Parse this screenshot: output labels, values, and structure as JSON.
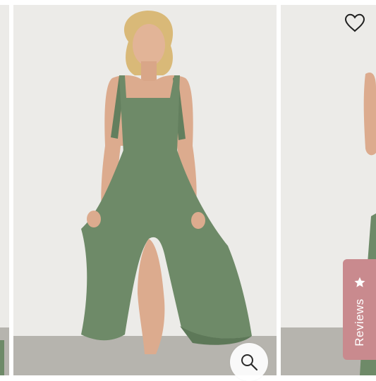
{
  "gallery": {
    "product_color": "#6e8a68",
    "backdrop_color": "#ecebe8",
    "floor_color": "#b6b4ae"
  },
  "icons": {
    "wishlist": "heart-icon",
    "zoom": "magnifier-icon",
    "reviews": "star-icon"
  },
  "reviews": {
    "label": "Reviews",
    "tab_color": "#c98a8e"
  }
}
